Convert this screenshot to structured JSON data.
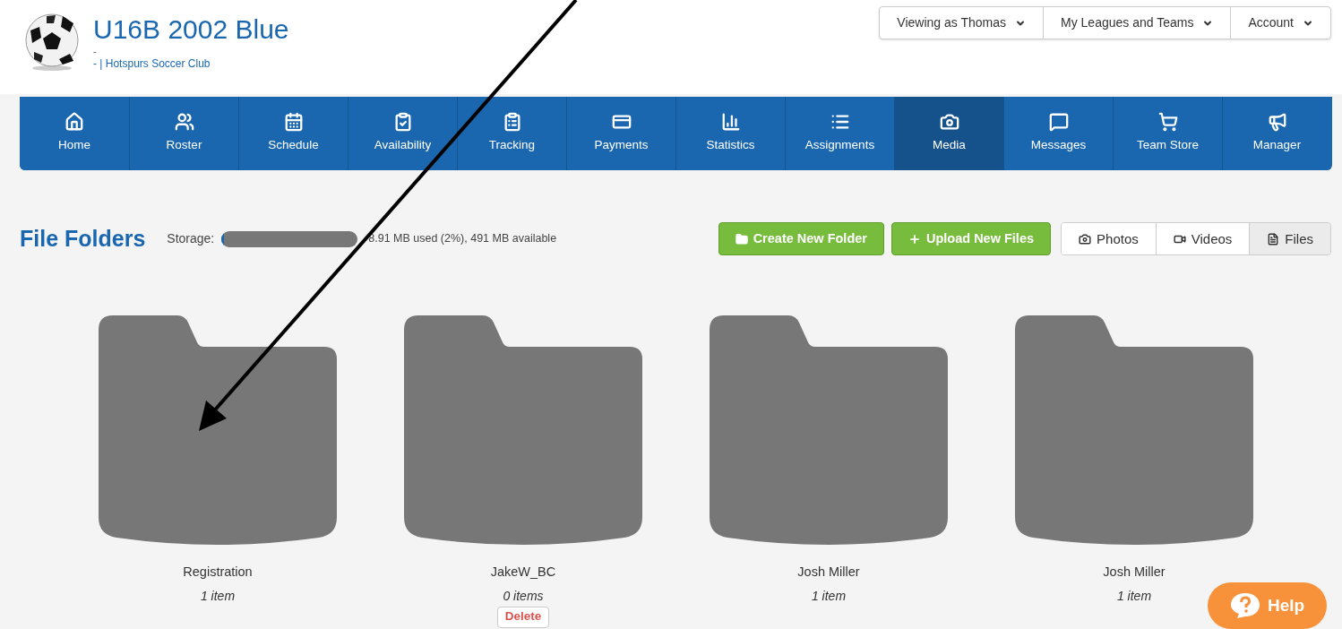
{
  "header": {
    "title": "U16B 2002 Blue",
    "subtitle": "-",
    "club_line": "- | Hotspurs Soccer Club"
  },
  "top_menu": [
    {
      "label": "Viewing as Thomas"
    },
    {
      "label": "My Leagues and Teams"
    },
    {
      "label": "Account"
    }
  ],
  "nav": [
    {
      "label": "Home",
      "selected": false
    },
    {
      "label": "Roster",
      "selected": false
    },
    {
      "label": "Schedule",
      "selected": false
    },
    {
      "label": "Availability",
      "selected": false
    },
    {
      "label": "Tracking",
      "selected": false
    },
    {
      "label": "Payments",
      "selected": false
    },
    {
      "label": "Statistics",
      "selected": false
    },
    {
      "label": "Assignments",
      "selected": false
    },
    {
      "label": "Media",
      "selected": true
    },
    {
      "label": "Messages",
      "selected": false
    },
    {
      "label": "Team Store",
      "selected": false
    },
    {
      "label": "Manager",
      "selected": false
    }
  ],
  "page_title": "File Folders",
  "storage": {
    "label": "Storage:",
    "level": 0.02,
    "reading": "8.91 MB used (2%), 491 MB available"
  },
  "actions": [
    {
      "label": "Create New Folder"
    },
    {
      "label": "Upload New Files"
    }
  ],
  "media_tabs": [
    {
      "label": "Photos",
      "selected": false
    },
    {
      "label": "Videos",
      "selected": false
    },
    {
      "label": "Files",
      "selected": true
    }
  ],
  "folders": [
    {
      "name": "Registration",
      "count": "1 item"
    },
    {
      "name": "JakeW_BC",
      "count": "0 items",
      "delete_label": "Delete"
    },
    {
      "name": "Josh Miller",
      "count": "1 item"
    },
    {
      "name": "Josh Miller",
      "count": "1 item"
    }
  ],
  "help": {
    "label": "Help"
  }
}
